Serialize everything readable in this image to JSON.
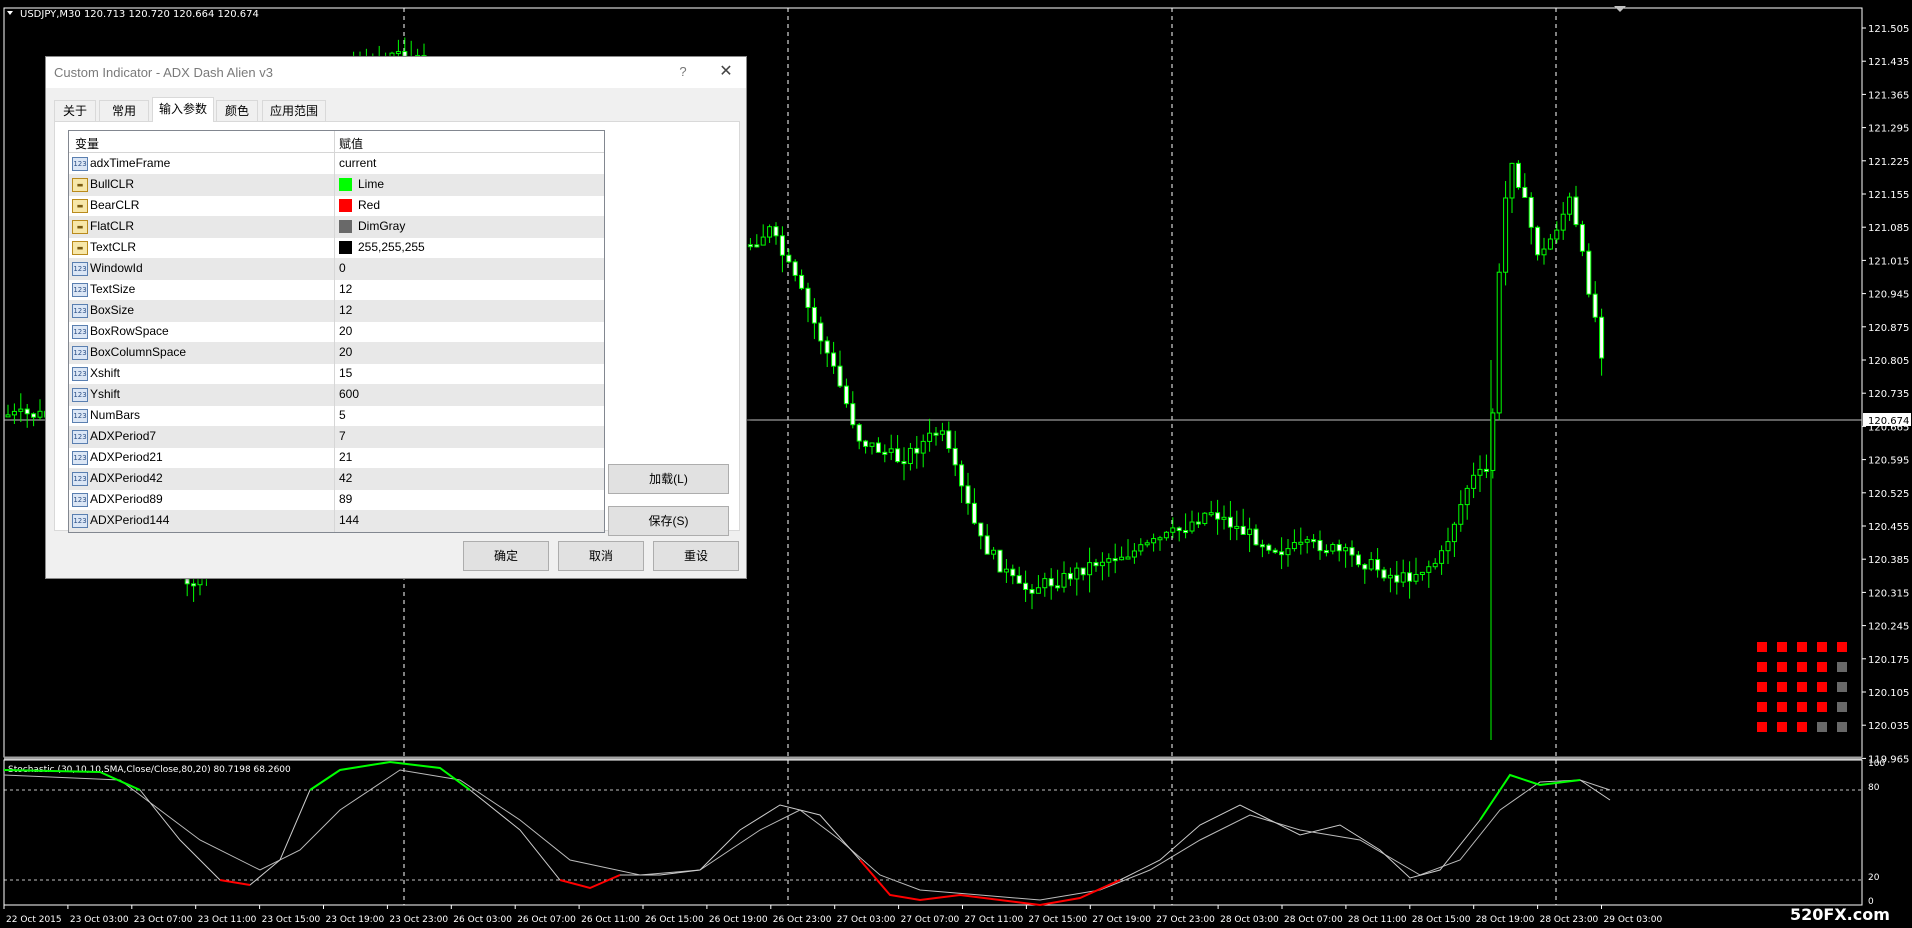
{
  "chart": {
    "header": "USDJPY,M30  120.713 120.720 120.664 120.674",
    "current_price": "120.674",
    "price_axis": [
      "121.505",
      "121.435",
      "121.365",
      "121.295",
      "121.225",
      "121.155",
      "121.085",
      "121.015",
      "120.945",
      "120.875",
      "120.805",
      "120.735",
      "120.665",
      "120.595",
      "120.525",
      "120.455",
      "120.385",
      "120.315",
      "120.245",
      "120.175",
      "120.105",
      "120.035",
      "119.965"
    ],
    "time_axis": [
      "22 Oct 2015",
      "23 Oct 03:00",
      "23 Oct 07:00",
      "23 Oct 11:00",
      "23 Oct 15:00",
      "23 Oct 19:00",
      "23 Oct 23:00",
      "26 Oct 03:00",
      "26 Oct 07:00",
      "26 Oct 11:00",
      "26 Oct 15:00",
      "26 Oct 19:00",
      "26 Oct 23:00",
      "27 Oct 03:00",
      "27 Oct 07:00",
      "27 Oct 11:00",
      "27 Oct 15:00",
      "27 Oct 19:00",
      "27 Oct 23:00",
      "28 Oct 03:00",
      "28 Oct 07:00",
      "28 Oct 11:00",
      "28 Oct 15:00",
      "28 Oct 19:00",
      "28 Oct 23:00",
      "29 Oct 03:00"
    ],
    "stochastic_label": "Stochastic (30,10,10,SMA,Close/Close,80,20) 80.7198 68.2600",
    "stoch_levels": [
      "100",
      "80",
      "20",
      "0"
    ],
    "colors": {
      "bull": "#00ff00",
      "bear": "#ff0000",
      "flat": "#696969",
      "text": "#ffffff",
      "grid": "#ffffff"
    }
  },
  "dialog": {
    "title": "Custom Indicator - ADX Dash Alien v3",
    "help": "?",
    "close": "✕",
    "tabs": [
      "关于",
      "常用",
      "输入参数",
      "颜色",
      "应用范围"
    ],
    "active_tab": "输入参数",
    "columns": [
      "变量",
      "赋值"
    ],
    "params": [
      {
        "name": "adxTimeFrame",
        "value": "current",
        "type": "123"
      },
      {
        "name": "BullCLR",
        "value": "Lime",
        "type": "color",
        "swatch": "#00ff00"
      },
      {
        "name": "BearCLR",
        "value": "Red",
        "type": "color",
        "swatch": "#ff0000"
      },
      {
        "name": "FlatCLR",
        "value": "DimGray",
        "type": "color",
        "swatch": "#696969"
      },
      {
        "name": "TextCLR",
        "value": "255,255,255",
        "type": "color",
        "swatch": "#000000"
      },
      {
        "name": "WindowId",
        "value": "0",
        "type": "123"
      },
      {
        "name": "TextSize",
        "value": "12",
        "type": "123"
      },
      {
        "name": "BoxSize",
        "value": "12",
        "type": "123"
      },
      {
        "name": "BoxRowSpace",
        "value": "20",
        "type": "123"
      },
      {
        "name": "BoxColumnSpace",
        "value": "20",
        "type": "123"
      },
      {
        "name": "Xshift",
        "value": "15",
        "type": "123"
      },
      {
        "name": "Yshift",
        "value": "600",
        "type": "123"
      },
      {
        "name": "NumBars",
        "value": "5",
        "type": "123"
      },
      {
        "name": "ADXPeriod7",
        "value": "7",
        "type": "123"
      },
      {
        "name": "ADXPeriod21",
        "value": "21",
        "type": "123"
      },
      {
        "name": "ADXPeriod42",
        "value": "42",
        "type": "123"
      },
      {
        "name": "ADXPeriod89",
        "value": "89",
        "type": "123"
      },
      {
        "name": "ADXPeriod144",
        "value": "144",
        "type": "123"
      }
    ],
    "buttons": {
      "load": "加载(L)",
      "save": "保存(S)",
      "ok": "确定",
      "cancel": "取消",
      "reset": "重设"
    }
  },
  "watermark": "520FX.com"
}
